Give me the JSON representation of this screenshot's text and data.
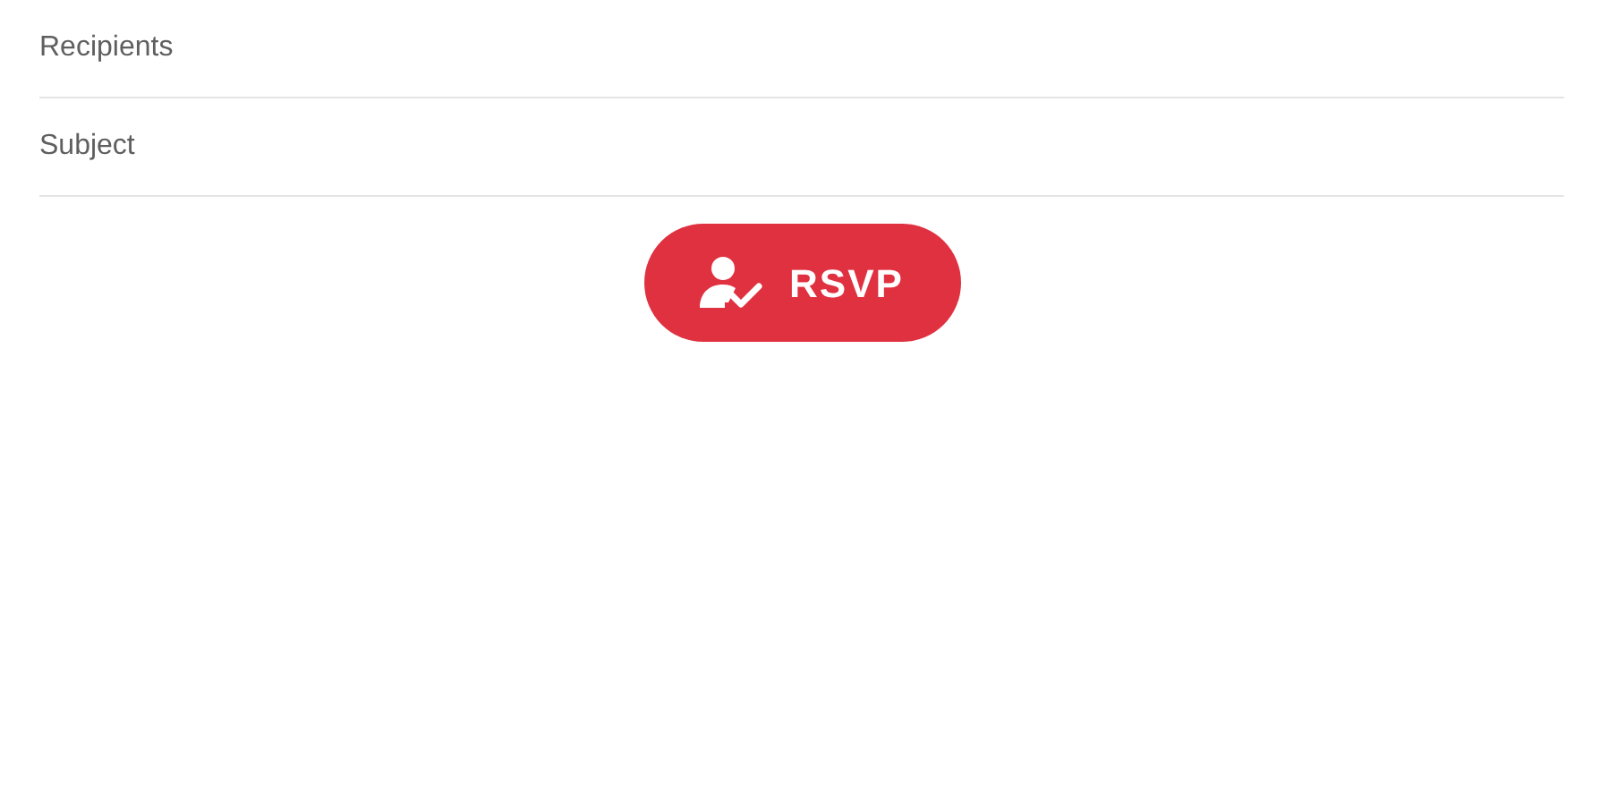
{
  "fields": [
    {
      "placeholder": "Recipients"
    },
    {
      "placeholder": "Subject"
    }
  ],
  "button": {
    "label": "RSVP"
  }
}
